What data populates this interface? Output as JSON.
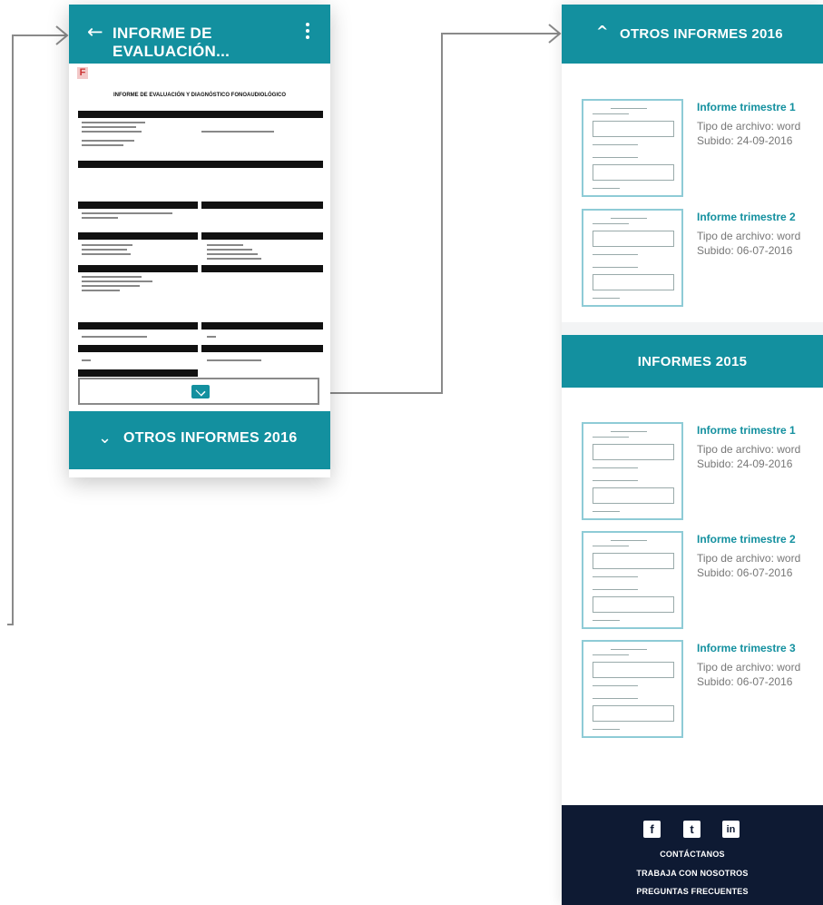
{
  "screen1": {
    "title": "INFORME DE EVALUACIÓN...",
    "back_icon": "←",
    "document": {
      "title": "INFORME DE EVALUACIÓN Y DIAGNÓSTICO FONOAUDIOLÓGICO"
    },
    "other_reports_label": "OTROS INFORMES 2016",
    "chevron_down": "⌄"
  },
  "screen2": {
    "section_2016": {
      "title": "OTROS INFORMES 2016",
      "chevron_up": "^",
      "reports": [
        {
          "title": "Informe trimestre 1",
          "type": "Tipo de archivo: word",
          "date": "Subido: 24-09-2016"
        },
        {
          "title": "Informe trimestre 2",
          "type": "Tipo de archivo: word",
          "date": "Subido: 06-07-2016"
        }
      ]
    },
    "section_2015": {
      "title": "INFORMES 2015",
      "reports": [
        {
          "title": "Informe trimestre 1",
          "type": "Tipo de archivo: word",
          "date": "Subido: 24-09-2016"
        },
        {
          "title": "Informe trimestre 2",
          "type": "Tipo de archivo: word",
          "date": "Subido: 06-07-2016"
        },
        {
          "title": "Informe trimestre 3",
          "type": "Tipo de archivo: word",
          "date": "Subido: 06-07-2016"
        }
      ]
    },
    "footer": {
      "facebook": "f",
      "twitter": "t",
      "linkedin": "in",
      "links": [
        "CONTÁCTANOS",
        "TRABAJA CON NOSOTROS",
        "PREGUNTAS FRECUENTES"
      ]
    }
  },
  "colors": {
    "accent": "#13909f",
    "footer": "#0e1a33",
    "thumb_border": "#8ecbd6"
  }
}
